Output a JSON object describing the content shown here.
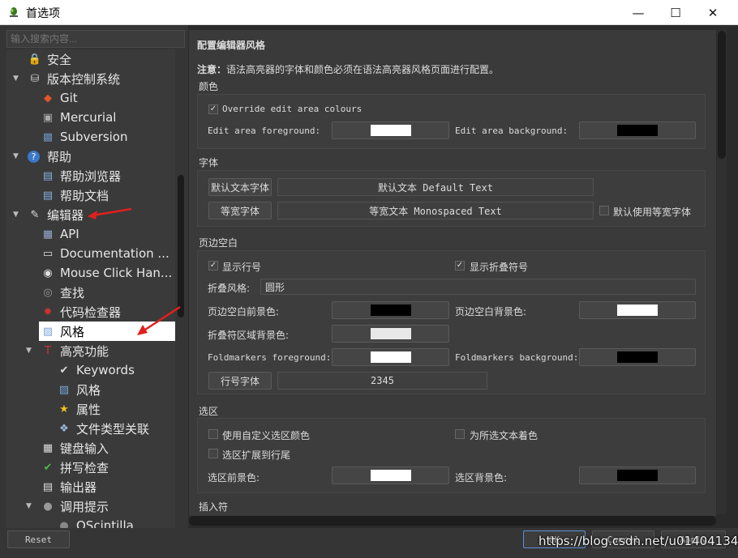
{
  "window": {
    "title": "首选项",
    "minimize": "—",
    "maximize": "☐",
    "close": "✕"
  },
  "search": {
    "placeholder": "输入搜索内容..."
  },
  "tree": [
    {
      "label": "安全",
      "icon": "lock-icon",
      "level": 1
    },
    {
      "label": "版本控制系统",
      "icon": "database-icon",
      "level": 1,
      "expanded": true
    },
    {
      "label": "Git",
      "icon": "git-icon",
      "level": 2
    },
    {
      "label": "Mercurial",
      "icon": "mercurial-icon",
      "level": 2
    },
    {
      "label": "Subversion",
      "icon": "subversion-icon",
      "level": 2
    },
    {
      "label": "帮助",
      "icon": "help-icon",
      "level": 1,
      "expanded": true
    },
    {
      "label": "帮助浏览器",
      "icon": "help-browser-icon",
      "level": 2
    },
    {
      "label": "帮助文档",
      "icon": "help-doc-icon",
      "level": 2
    },
    {
      "label": "编辑器",
      "icon": "editor-icon",
      "level": 1,
      "expanded": true
    },
    {
      "label": "API",
      "icon": "api-icon",
      "level": 2
    },
    {
      "label": "Documentation ...",
      "icon": "documentation-icon",
      "level": 2
    },
    {
      "label": "Mouse Click Han...",
      "icon": "mouse-icon",
      "level": 2
    },
    {
      "label": "查找",
      "icon": "find-icon",
      "level": 2
    },
    {
      "label": "代码检查器",
      "icon": "bug-icon",
      "level": 2
    },
    {
      "label": "风格",
      "icon": "style-icon",
      "level": 2,
      "selected": true
    },
    {
      "label": "高亮功能",
      "icon": "highlight-icon",
      "level": 2,
      "expanded": true
    },
    {
      "label": "Keywords",
      "icon": "keywords-icon",
      "level": 3
    },
    {
      "label": "风格",
      "icon": "style-icon",
      "level": 3
    },
    {
      "label": "属性",
      "icon": "star-icon",
      "level": 3
    },
    {
      "label": "文件类型关联",
      "icon": "filetype-icon",
      "level": 3
    },
    {
      "label": "键盘输入",
      "icon": "keyboard-icon",
      "level": 2
    },
    {
      "label": "拼写检查",
      "icon": "spellcheck-icon",
      "level": 2
    },
    {
      "label": "输出器",
      "icon": "output-icon",
      "level": 2
    },
    {
      "label": "调用提示",
      "icon": "calltip-icon",
      "level": 2,
      "expanded": true
    },
    {
      "label": "QScintilla",
      "icon": "qscintilla-icon",
      "level": 3
    }
  ],
  "page": {
    "heading": "配置编辑器风格",
    "note_bold": "注意：",
    "note_text": "语法高亮器的字体和颜色必须在语法高亮器风格页面进行配置。",
    "colors": {
      "title": "颜色",
      "override_label": "Override edit area colours",
      "override_checked": true,
      "fg_label": "Edit area foreground:",
      "fg_color": "#ffffff",
      "bg_label": "Edit area background:",
      "bg_color": "#000000"
    },
    "fonts": {
      "title": "字体",
      "default_btn": "默认文本字体",
      "default_sample": "默认文本 Default Text",
      "mono_btn": "等宽字体",
      "mono_sample": "等宽文本 Monospaced Text",
      "use_mono_label": "默认使用等宽字体",
      "use_mono_checked": false
    },
    "margins": {
      "title": "页边空白",
      "show_line_numbers": "显示行号",
      "show_line_numbers_checked": true,
      "show_fold_markers": "显示折叠符号",
      "show_fold_markers_checked": true,
      "fold_style_label": "折叠风格:",
      "fold_style_value": "圆形",
      "margin_fg_label": "页边空白前景色:",
      "margin_fg_color": "#000000",
      "margin_bg_label": "页边空白背景色:",
      "margin_bg_color": "#ffffff",
      "fold_area_bg_label": "折叠符区域背景色:",
      "fold_area_bg_color": "#e8e8e8",
      "fold_fg_label": "Foldmarkers foreground:",
      "fold_fg_color": "#ffffff",
      "fold_bg_label": "Foldmarkers background:",
      "fold_bg_color": "#000000",
      "line_num_font_btn": "行号字体",
      "line_num_font_sample": "2345"
    },
    "selection": {
      "title": "选区",
      "custom_sel_color": "使用自定义选区颜色",
      "custom_sel_color_checked": false,
      "color_all_text": "为所选文本着色",
      "color_all_text_checked": false,
      "extend_eol": "选区扩展到行尾",
      "extend_eol_checked": false,
      "sel_fg_label": "选区前景色:",
      "sel_fg_color": "#ffffff",
      "sel_bg_label": "选区背景色:",
      "sel_bg_color": "#000000"
    },
    "caret_title": "插入符"
  },
  "buttons": {
    "reset": "Reset",
    "ok": "OK",
    "cancel": "Cancel",
    "apply": "Apply"
  },
  "watermark": "https://blog.csdn.net/u014041346",
  "accent": "#e0201e"
}
